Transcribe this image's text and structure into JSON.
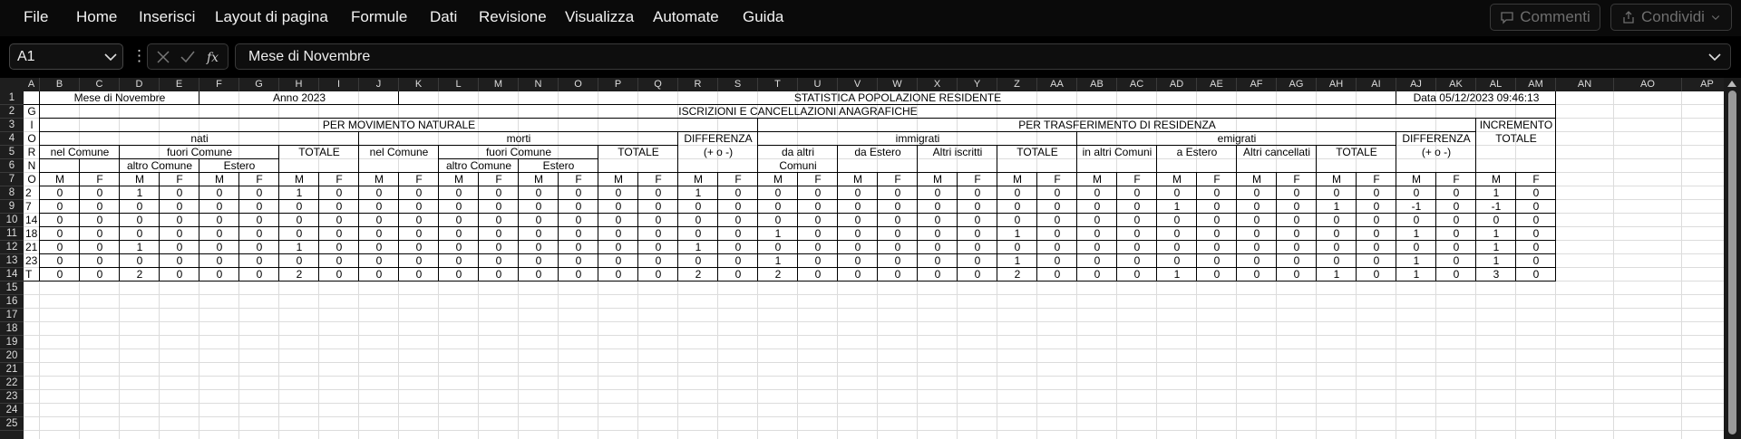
{
  "menu": {
    "items": [
      "File",
      "Home",
      "Inserisci",
      "Layout di pagina",
      "Formule",
      "Dati",
      "Revisione",
      "Visualizza",
      "Automate",
      "Guida"
    ],
    "comments_label": "Commenti",
    "share_label": "Condividi"
  },
  "formula_bar": {
    "name_box": "A1",
    "formula": "Mese di Novembre"
  },
  "columns": [
    "A",
    "B",
    "C",
    "D",
    "E",
    "F",
    "G",
    "H",
    "I",
    "J",
    "K",
    "L",
    "M",
    "N",
    "O",
    "P",
    "Q",
    "R",
    "S",
    "T",
    "U",
    "V",
    "W",
    "X",
    "Y",
    "Z",
    "AA",
    "AB",
    "AC",
    "AD",
    "AE",
    "AF",
    "AG",
    "AH",
    "AI",
    "AJ",
    "AK",
    "AL",
    "AM",
    "AN",
    "AO",
    "AP"
  ],
  "rows": [
    "1",
    "2",
    "3",
    "4",
    "5",
    "6",
    "7",
    "8",
    "9",
    "10",
    "11",
    "12",
    "13",
    "14",
    "15",
    "16",
    "17",
    "18",
    "19",
    "20",
    "21",
    "22",
    "23",
    "24",
    "25"
  ],
  "sheet": {
    "month_label": "Mese di Novembre",
    "year_label": "Anno 2023",
    "stat_title": "STATISTICA POPOLAZIONE RESIDENTE",
    "date_label": "Data 05/12/2023 09:46:13",
    "iscrizioni": "ISCRIZIONI E CANCELLAZIONI ANAGRAFICHE",
    "giorno_letters": [
      "G",
      "I",
      "O",
      "R",
      "N",
      "O"
    ],
    "movimento_naturale": "PER MOVIMENTO NATURALE",
    "trasferimento": "PER TRASFERIMENTO DI RESIDENZA",
    "incremento_1": "INCREMENTO",
    "incremento_2": "TOTALE",
    "nati": "nati",
    "morti": "morti",
    "differenza_1": "DIFFERENZA",
    "differenza_2": "(+ o -)",
    "immigrati": "immigrati",
    "emigrati": "emigrati",
    "nel_comune": "nel Comune",
    "fuori_comune": "fuori Comune",
    "totale": "TOTALE",
    "da_altri": "da altri",
    "comuni": "Comuni",
    "da_estero": "da Estero",
    "altri_iscritti": "Altri iscritti",
    "in_altri_comuni": "in altri Comuni",
    "a_estero": "a Estero",
    "altri_cancellati": "Altri cancellati",
    "altro_comune": "altro Comune",
    "estero": "Estero",
    "m": "M",
    "f": "F",
    "data_rows": [
      {
        "day": "2",
        "values": [
          "0",
          "0",
          "1",
          "0",
          "0",
          "0",
          "1",
          "0",
          "0",
          "0",
          "0",
          "0",
          "0",
          "0",
          "0",
          "0",
          "1",
          "0",
          "0",
          "0",
          "0",
          "0",
          "0",
          "0",
          "0",
          "0",
          "0",
          "0",
          "0",
          "0",
          "0",
          "0",
          "0",
          "0",
          "0",
          "0",
          "1",
          "0"
        ]
      },
      {
        "day": "7",
        "values": [
          "0",
          "0",
          "0",
          "0",
          "0",
          "0",
          "0",
          "0",
          "0",
          "0",
          "0",
          "0",
          "0",
          "0",
          "0",
          "0",
          "0",
          "0",
          "0",
          "0",
          "0",
          "0",
          "0",
          "0",
          "0",
          "0",
          "0",
          "0",
          "1",
          "0",
          "0",
          "0",
          "1",
          "0",
          "-1",
          "0",
          "-1",
          "0"
        ]
      },
      {
        "day": "14",
        "values": [
          "0",
          "0",
          "0",
          "0",
          "0",
          "0",
          "0",
          "0",
          "0",
          "0",
          "0",
          "0",
          "0",
          "0",
          "0",
          "0",
          "0",
          "0",
          "0",
          "0",
          "0",
          "0",
          "0",
          "0",
          "0",
          "0",
          "0",
          "0",
          "0",
          "0",
          "0",
          "0",
          "0",
          "0",
          "0",
          "0",
          "0",
          "0"
        ]
      },
      {
        "day": "18",
        "values": [
          "0",
          "0",
          "0",
          "0",
          "0",
          "0",
          "0",
          "0",
          "0",
          "0",
          "0",
          "0",
          "0",
          "0",
          "0",
          "0",
          "0",
          "0",
          "1",
          "0",
          "0",
          "0",
          "0",
          "0",
          "1",
          "0",
          "0",
          "0",
          "0",
          "0",
          "0",
          "0",
          "0",
          "0",
          "1",
          "0",
          "1",
          "0"
        ]
      },
      {
        "day": "21",
        "values": [
          "0",
          "0",
          "1",
          "0",
          "0",
          "0",
          "1",
          "0",
          "0",
          "0",
          "0",
          "0",
          "0",
          "0",
          "0",
          "0",
          "1",
          "0",
          "0",
          "0",
          "0",
          "0",
          "0",
          "0",
          "0",
          "0",
          "0",
          "0",
          "0",
          "0",
          "0",
          "0",
          "0",
          "0",
          "0",
          "0",
          "1",
          "0"
        ]
      },
      {
        "day": "23",
        "values": [
          "0",
          "0",
          "0",
          "0",
          "0",
          "0",
          "0",
          "0",
          "0",
          "0",
          "0",
          "0",
          "0",
          "0",
          "0",
          "0",
          "0",
          "0",
          "1",
          "0",
          "0",
          "0",
          "0",
          "0",
          "1",
          "0",
          "0",
          "0",
          "0",
          "0",
          "0",
          "0",
          "0",
          "0",
          "1",
          "0",
          "1",
          "0"
        ]
      },
      {
        "day": "T",
        "values": [
          "0",
          "0",
          "2",
          "0",
          "0",
          "0",
          "2",
          "0",
          "0",
          "0",
          "0",
          "0",
          "0",
          "0",
          "0",
          "0",
          "2",
          "0",
          "2",
          "0",
          "0",
          "0",
          "0",
          "0",
          "2",
          "0",
          "0",
          "0",
          "1",
          "0",
          "0",
          "0",
          "1",
          "0",
          "1",
          "0",
          "3",
          "0"
        ]
      }
    ]
  }
}
